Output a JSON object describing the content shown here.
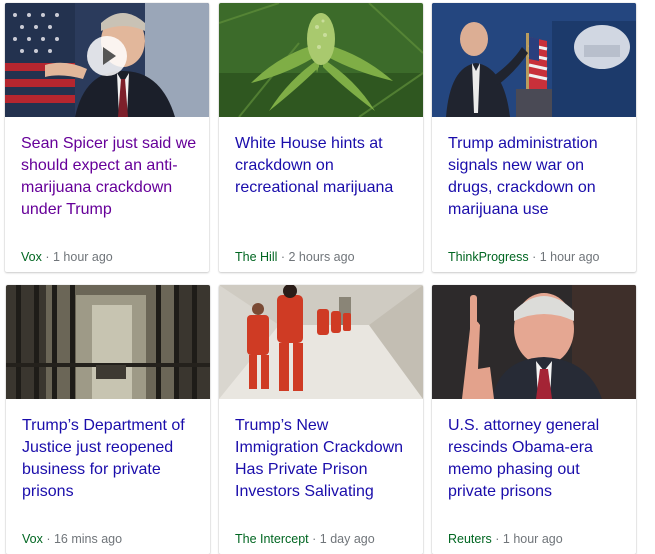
{
  "cards": [
    {
      "title": "Sean Spicer just said we should expect an anti-marijuana crackdown under Trump",
      "source": "Vox",
      "time": "1 hour ago",
      "visited": true,
      "image": "press-briefing-podium-photo",
      "has_video": true
    },
    {
      "title": "White House hints at crackdown on recreational marijuana",
      "source": "The Hill",
      "time": "2 hours ago",
      "visited": false,
      "image": "marijuana-plant-photo",
      "has_video": false
    },
    {
      "title": "Trump administration signals new war on drugs, crackdown on marijuana use",
      "source": "ThinkProgress",
      "time": "1 hour ago",
      "visited": false,
      "image": "white-house-briefing-photo",
      "has_video": false
    },
    {
      "title": "Trump’s Department of Justice just reopened business for private prisons",
      "source": "Vox",
      "time": "16 mins ago",
      "visited": false,
      "image": "prison-cell-bars-photo",
      "has_video": false
    },
    {
      "title": "Trump’s New Immigration Crackdown Has Private Prison Investors Salivating",
      "source": "The Intercept",
      "time": "1 day ago",
      "visited": false,
      "image": "inmates-in-corridor-photo",
      "has_video": false
    },
    {
      "title": "U.S. attorney general rescinds Obama-era memo phasing out private prisons",
      "source": "Reuters",
      "time": "1 hour ago",
      "visited": false,
      "image": "attorney-general-speaking-photo",
      "has_video": false
    }
  ],
  "colors": {
    "visited_link": "#660099",
    "link": "#1a0dab",
    "source": "#006621",
    "meta": "#70757a"
  }
}
